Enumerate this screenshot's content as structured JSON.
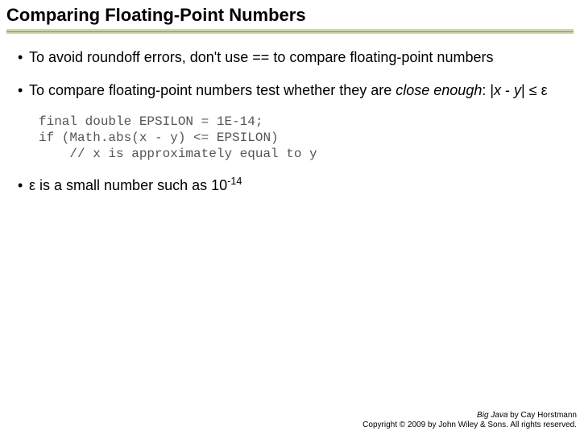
{
  "title": "Comparing Floating-Point Numbers",
  "bullets": {
    "b1a": "To avoid roundoff errors, don't use ",
    "b1code": "==",
    "b1b": " to compare floating-point numbers",
    "b2a": "To compare floating-point numbers test whether they are ",
    "b2em": "close enough",
    "b2b": ": |",
    "b2x": "x",
    "b2mid": " - ",
    "b2y": "y",
    "b2c": "| ≤ ε",
    "b3a": "ε is a small number such as 10",
    "b3sup": "-14"
  },
  "code": "final double EPSILON = 1E-14;\nif (Math.abs(x - y) <= EPSILON)\n    // x is approximately equal to y",
  "footer": {
    "book": "Big Java",
    "by": " by Cay Horstmann",
    "copy": "Copyright © 2009 by John Wiley & Sons.  All rights reserved."
  }
}
